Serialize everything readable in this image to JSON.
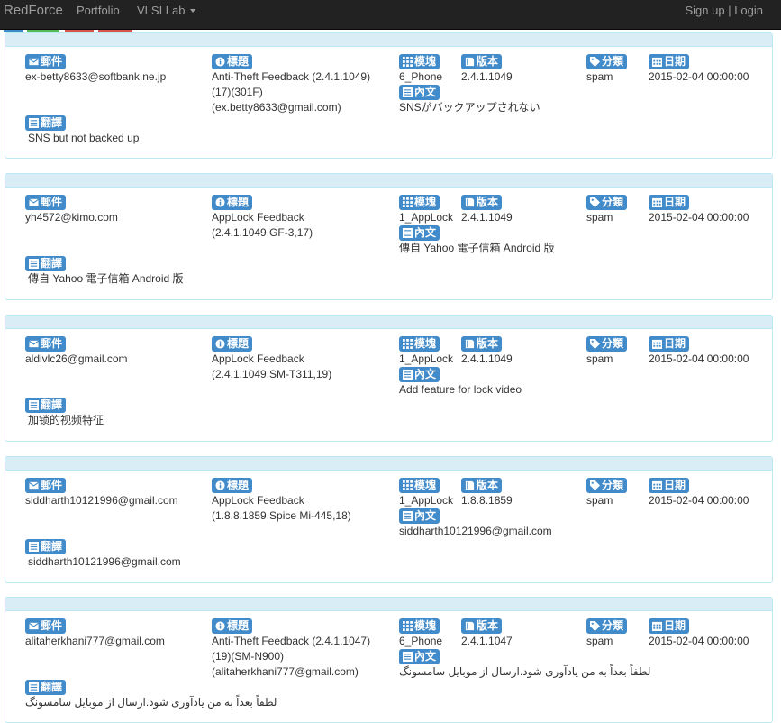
{
  "navbar": {
    "brand": "RedForce",
    "portfolio": "Portfolio",
    "vlsi": "VLSI Lab",
    "auth": "Sign up | Login"
  },
  "labels": {
    "email": "郵件",
    "title": "標題",
    "module": "模塊",
    "version": "版本",
    "category": "分類",
    "date": "日期",
    "body": "內文",
    "translation": "翻譯"
  },
  "colors": {
    "label_bg": "#428bca",
    "card_head": "#d9edf7",
    "card_border": "#bce8f1",
    "navbar": "#222222"
  },
  "records": [
    {
      "email": "ex-betty8633@softbank.ne.jp",
      "title": [
        "Anti-Theft Feedback (2.4.1.1049)",
        "(17)(301F)",
        "(ex.betty8633@gmail.com)"
      ],
      "module": "6_Phone",
      "version": "2.4.1.1049",
      "category": "spam",
      "date": "2015-02-04 00:00:00",
      "body": "SNSがバックアップされない",
      "translation": "SNS but not backed up"
    },
    {
      "email": "yh4572@kimo.com",
      "title": [
        "AppLock Feedback",
        "(2.4.1.1049,GF-3,17)"
      ],
      "module": "1_AppLock",
      "version": "2.4.1.1049",
      "category": "spam",
      "date": "2015-02-04 00:00:00",
      "body": "傳自 Yahoo 電子信箱 Android 版",
      "translation": "傳自 Yahoo 電子信箱 Android 版"
    },
    {
      "email": "aldivlc26@gmail.com",
      "title": [
        "AppLock Feedback",
        "(2.4.1.1049,SM-T311,19)"
      ],
      "module": "1_AppLock",
      "version": "2.4.1.1049",
      "category": "spam",
      "date": "2015-02-04 00:00:00",
      "body": "Add feature for lock video",
      "translation": "加锁的视频特征"
    },
    {
      "email": "siddharth10121996@gmail.com",
      "title": [
        "AppLock Feedback",
        "(1.8.8.1859,Spice Mi-445,18)"
      ],
      "module": "1_AppLock",
      "version": "1.8.8.1859",
      "category": "spam",
      "date": "2015-02-04 00:00:00",
      "body": "siddharth10121996@gmail.com",
      "translation": "siddharth10121996@gmail.com"
    },
    {
      "email": "alitaherkhani777@gmail.com",
      "title": [
        "Anti-Theft Feedback (2.4.1.1047)",
        "(19)(SM-N900)",
        "(alitaherkhani777@gmail.com)"
      ],
      "module": "6_Phone",
      "version": "2.4.1.1047",
      "category": "spam",
      "date": "2015-02-04 00:00:00",
      "body": "لطفاً بعداً به من یادآوری شود.ارسال از موبایل سامسونگ",
      "translation": "لطفاً بعداً به من یادآوری شود.ارسال از موبایل سامسونگ"
    }
  ]
}
